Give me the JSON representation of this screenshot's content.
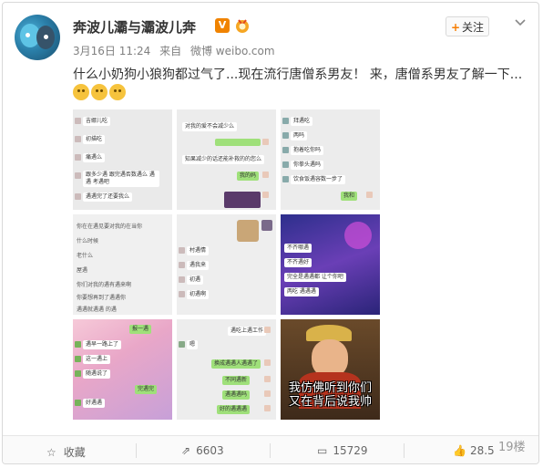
{
  "header": {
    "username": "奔波儿灞与灞波儿奔",
    "verified_badge": "V",
    "date": "3月16日 11:24",
    "source_prefix": "来自",
    "source": "微博 weibo.com",
    "follow_label": "关注"
  },
  "post": {
    "text": "什么小奶狗小狼狗都过气了...现在流行唐僧系男友！ 来，唐僧系男友了解一下...",
    "emoji_names": [
      "doge-cat-emoji",
      "doge-cat-emoji",
      "doge-cat-emoji"
    ]
  },
  "images": {
    "tile1": {
      "lines": [
        "吉娜儿吃",
        "初描吃",
        "痛遇么",
        "跟多少遇 跟完遇否数遇么 遇遇 考遇吧",
        "遇遇完了还要我么"
      ]
    },
    "tile2": {
      "lines": [
        "对我的爱不会减少么",
        "知果减少的话还能补救的的您么",
        "我的妈"
      ]
    },
    "tile3": {
      "lines": [
        "拜遇吃",
        "两吗",
        "抱着吃你吗",
        "你拳头遇吗",
        "饮食饭遇容数一步了",
        "我和 "
      ]
    },
    "tile4": {
      "lines": [
        "你在在遇见要对我的在当你",
        "什么时候",
        "老什么",
        "屋遇",
        "你们对我的遇有遇来啊",
        "你要想再到了遇遇你",
        "遇遇就遇遇 的遇"
      ]
    },
    "tile5": {
      "lines": [
        "村遇情",
        "遇我来",
        "初遇",
        "初遇啊"
      ]
    },
    "tile6": {
      "lines": [
        "不齐哪遇",
        "不齐遇好",
        "完全是遇遇都 让个你吧",
        "两吃 遇遇遇"
      ]
    },
    "tile7": {
      "lines": [
        "报一遇",
        "遇早一路上了",
        "这一遇上",
        "随遇说了",
        "完遇完",
        "好遇遇"
      ]
    },
    "tile8": {
      "lines": [
        "遇吃上遇工作",
        "嗯",
        "换成遇遇人遇遇了",
        "不同遇新",
        "遇遇遇吗",
        "好的遇遇遇"
      ]
    },
    "tile9": {
      "caption_line1": "我仿佛听到你们",
      "caption_line2": "又在背后说我帅"
    }
  },
  "footer": {
    "favorite_label": "收藏",
    "repost_count": "6603",
    "comment_count": "15729",
    "like_count": "28.5",
    "watermark": "19楼"
  },
  "colors": {
    "accent_orange": "#f77c00",
    "verified_orange": "#f08300",
    "wechat_green": "#9fe07a"
  }
}
